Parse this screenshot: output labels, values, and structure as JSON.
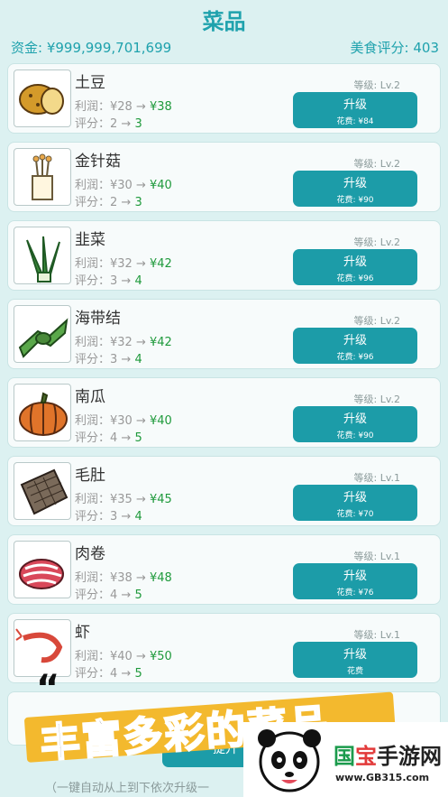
{
  "header": {
    "title": "菜品",
    "funds": "资金: ¥999,999,701,699",
    "score": "美食评分: 403"
  },
  "items": [
    {
      "name": "土豆",
      "profit_from": "利润：¥28 → ",
      "profit_to": "¥38",
      "score_from": "评分：2 → ",
      "score_to": "3",
      "level": "等级: Lv.2",
      "button": "升级",
      "cost": "花费: ¥84",
      "icon": "potato-icon"
    },
    {
      "name": "金针菇",
      "profit_from": "利润：¥30 → ",
      "profit_to": "¥40",
      "score_from": "评分：2 → ",
      "score_to": "3",
      "level": "等级: Lv.2",
      "button": "升级",
      "cost": "花费: ¥90",
      "icon": "mushroom-icon"
    },
    {
      "name": "韭菜",
      "profit_from": "利润：¥32 → ",
      "profit_to": "¥42",
      "score_from": "评分：3 → ",
      "score_to": "4",
      "level": "等级: Lv.2",
      "button": "升级",
      "cost": "花费: ¥96",
      "icon": "chives-icon"
    },
    {
      "name": "海带结",
      "profit_from": "利润：¥32 → ",
      "profit_to": "¥42",
      "score_from": "评分：3 → ",
      "score_to": "4",
      "level": "等级: Lv.2",
      "button": "升级",
      "cost": "花费: ¥96",
      "icon": "seaweed-knot-icon"
    },
    {
      "name": "南瓜",
      "profit_from": "利润：¥30 → ",
      "profit_to": "¥40",
      "score_from": "评分：4 → ",
      "score_to": "5",
      "level": "等级: Lv.2",
      "button": "升级",
      "cost": "花费: ¥90",
      "icon": "pumpkin-icon"
    },
    {
      "name": "毛肚",
      "profit_from": "利润：¥35 → ",
      "profit_to": "¥45",
      "score_from": "评分：3 → ",
      "score_to": "4",
      "level": "等级: Lv.1",
      "button": "升级",
      "cost": "花费: ¥70",
      "icon": "tripe-icon"
    },
    {
      "name": "肉卷",
      "profit_from": "利润：¥38 → ",
      "profit_to": "¥48",
      "score_from": "评分：4 → ",
      "score_to": "5",
      "level": "等级: Lv.1",
      "button": "升级",
      "cost": "花费: ¥76",
      "icon": "meat-roll-icon"
    },
    {
      "name": "虾",
      "profit_from": "利润：¥40 → ",
      "profit_to": "¥50",
      "score_from": "评分：4 → ",
      "score_to": "5",
      "level": "等级: Lv.1",
      "button": "升级",
      "cost": "花费",
      "icon": "shrimp-icon"
    }
  ],
  "footer": {
    "button": "提升",
    "hint": "（一键自动从上到下依次升级一"
  },
  "banner": {
    "quote": "“",
    "text": "丰富多彩的菜品"
  },
  "watermark": {
    "name_a": "国",
    "name_b": "宝",
    "name_c": "手游网",
    "url": "www.GB315.com"
  }
}
